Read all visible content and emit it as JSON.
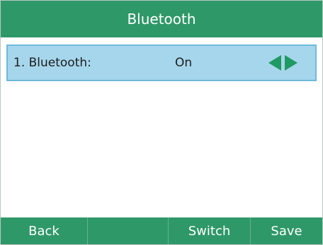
{
  "screen": {
    "title": "Bluetooth"
  },
  "menu": {
    "items": [
      {
        "label": "1. Bluetooth:",
        "value": "On"
      }
    ]
  },
  "softkeys": [
    "Back",
    "",
    "Switch",
    "Save"
  ],
  "colors": {
    "header": "#2f9868",
    "selection": "#a6d6ec",
    "arrow": "#1f9a62"
  },
  "icons": [
    "left-arrow-icon",
    "right-arrow-icon"
  ]
}
